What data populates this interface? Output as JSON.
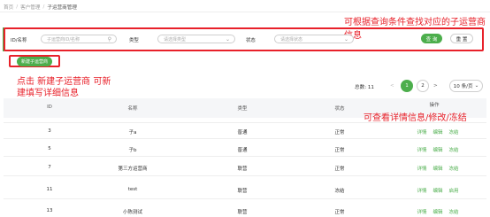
{
  "breadcrumb": [
    "首页",
    "客户管理",
    "子运营商管理"
  ],
  "breadcrumb_sep": "/",
  "search": {
    "id_label": "ID/名称",
    "id_placeholder": "子运营商ID/名称",
    "type_label": "类型",
    "type_placeholder": "请选择类型",
    "status_label": "状态",
    "status_placeholder": "请选择状态",
    "query_button": "查 询",
    "reset_button": "重 置"
  },
  "new_button": "新建子运营商",
  "annotations": {
    "search_hint": "可根据查询条件查找对应的子运营商信息",
    "new_hint_line1": "点击 新建子运营商 可新",
    "new_hint_line2": "建填写详细信息",
    "action_hint": "可查看详情信息/修改/冻结"
  },
  "pagination": {
    "total": "总数: 11",
    "prev": "<",
    "page1": "1",
    "page2": "2",
    "next": ">",
    "page_size": "10 条/页"
  },
  "table": {
    "columns": [
      "ID",
      "名称",
      "类型",
      "状态",
      "操作"
    ],
    "rows": [
      {
        "id": "3",
        "name": "子a",
        "type": "普通",
        "status": "正常",
        "actions": [
          "详情",
          "编辑",
          "冻结"
        ]
      },
      {
        "id": "5",
        "name": "子b",
        "type": "普通",
        "status": "正常",
        "actions": [
          "详情",
          "编辑",
          "冻结"
        ]
      },
      {
        "id": "7",
        "name": "第三方运营商",
        "type": "联营",
        "status": "正常",
        "actions": [
          "详情",
          "编辑",
          "冻结"
        ]
      },
      {
        "id": "11",
        "name": "test",
        "type": "联营",
        "status": "冻结",
        "actions": [
          "详情",
          "编辑",
          "启用"
        ]
      },
      {
        "id": "13",
        "name": "小陈测试",
        "type": "联营",
        "status": "正常",
        "actions": [
          "详情",
          "编辑",
          "冻结"
        ]
      }
    ]
  }
}
